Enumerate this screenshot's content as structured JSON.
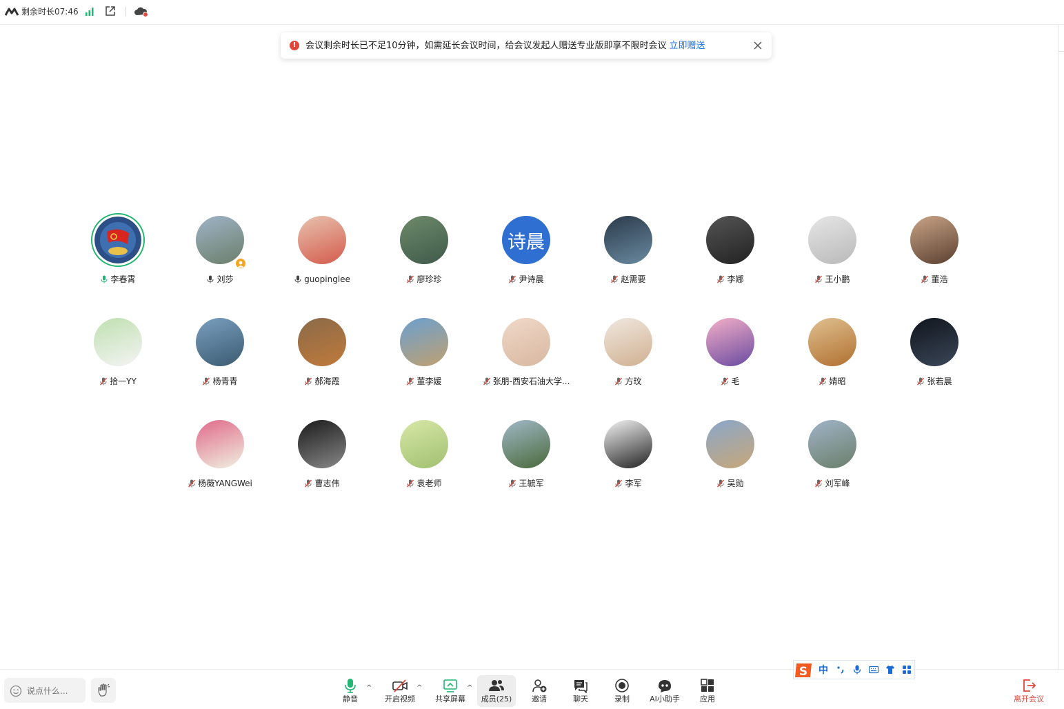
{
  "topbar": {
    "timer_text": "剩余时长07:46",
    "icons": [
      "logo-icon",
      "signal-icon",
      "popout-icon",
      "cloud-record-icon"
    ]
  },
  "banner": {
    "message": "会议剩余时长已不足10分钟，如需延长会议时间，给会议发起人赠送专业版即享不限时会议",
    "link_label": "立即赠送"
  },
  "participants": [
    {
      "name": "李春霄",
      "mic": "on-active",
      "avatar": "badge"
    },
    {
      "name": "刘莎",
      "mic": "on",
      "avatar": "photo",
      "host": true
    },
    {
      "name": "guopinglee",
      "mic": "on",
      "avatar": "photo"
    },
    {
      "name": "廖珍珍",
      "mic": "muted",
      "avatar": "photo"
    },
    {
      "name": "尹诗晨",
      "mic": "muted",
      "avatar": "text",
      "avatar_text": "诗晨"
    },
    {
      "name": "赵需要",
      "mic": "muted",
      "avatar": "photo"
    },
    {
      "name": "李娜",
      "mic": "muted",
      "avatar": "photo"
    },
    {
      "name": "王小鹏",
      "mic": "muted",
      "avatar": "photo"
    },
    {
      "name": "董浩",
      "mic": "muted",
      "avatar": "photo"
    },
    {
      "name": "拾一YY",
      "mic": "muted",
      "avatar": "photo"
    },
    {
      "name": "杨青青",
      "mic": "muted",
      "avatar": "photo"
    },
    {
      "name": "郝海霞",
      "mic": "muted",
      "avatar": "photo"
    },
    {
      "name": "董李媛",
      "mic": "muted",
      "avatar": "photo"
    },
    {
      "name": "张朋-西安石油大学...",
      "mic": "muted",
      "avatar": "photo"
    },
    {
      "name": "方玟",
      "mic": "muted",
      "avatar": "photo"
    },
    {
      "name": "毛",
      "mic": "muted",
      "avatar": "photo"
    },
    {
      "name": "婧昭",
      "mic": "muted",
      "avatar": "photo"
    },
    {
      "name": "张若晨",
      "mic": "muted",
      "avatar": "photo"
    },
    {
      "name": "杨薇YANGWei",
      "mic": "muted",
      "avatar": "photo"
    },
    {
      "name": "曹志伟",
      "mic": "muted",
      "avatar": "photo"
    },
    {
      "name": "袁老师",
      "mic": "muted",
      "avatar": "photo"
    },
    {
      "name": "王毓军",
      "mic": "muted",
      "avatar": "photo"
    },
    {
      "name": "李军",
      "mic": "muted",
      "avatar": "photo"
    },
    {
      "name": "吴勋",
      "mic": "muted",
      "avatar": "photo"
    },
    {
      "name": "刘军峰",
      "mic": "muted",
      "avatar": "photo"
    }
  ],
  "bottombar": {
    "chat_placeholder": "说点什么...",
    "mute_label": "静音",
    "video_label": "开启视频",
    "share_label": "共享屏幕",
    "members_label": "成员(25)",
    "invite_label": "邀请",
    "chat_label": "聊天",
    "record_label": "录制",
    "ai_label": "AI小助手",
    "apps_label": "应用",
    "leave_label": "离开会议"
  },
  "ime": {
    "lang_label": "中"
  },
  "colors": {
    "accent_green": "#22b573",
    "link_blue": "#1a73e8",
    "alert_red": "#e0483b",
    "muted_red": "#e0483b",
    "text_avatar_blue": "#2f6fd1"
  }
}
